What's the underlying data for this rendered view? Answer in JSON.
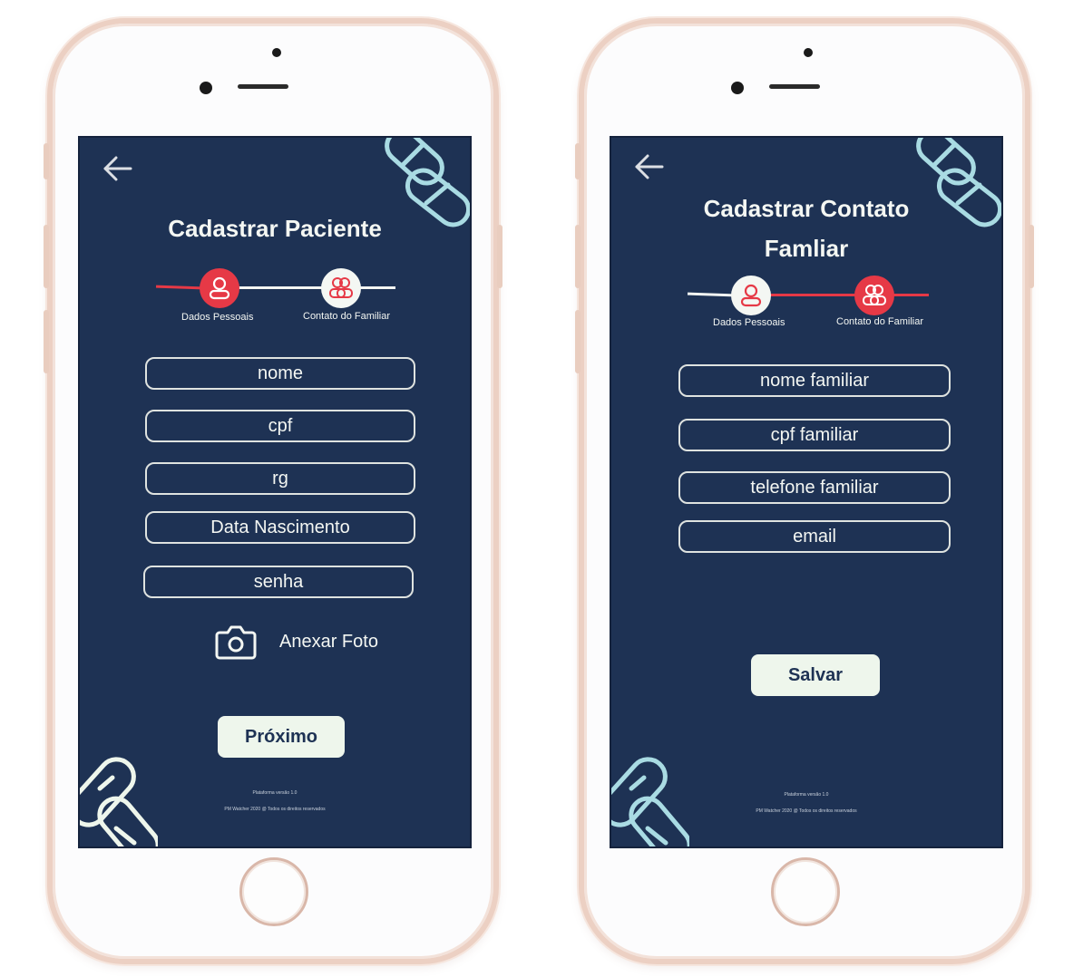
{
  "colors": {
    "screen_bg": "#1e3254",
    "accent_red": "#e63946",
    "pill_teal": "#a9dbe3",
    "button_bg": "#eef6ec",
    "text_light": "#f4f7f3"
  },
  "screen1": {
    "title": "Cadastrar Paciente",
    "steps": [
      {
        "label": "Dados Pessoais",
        "icon": "user-icon",
        "active": true
      },
      {
        "label": "Contato do Familiar",
        "icon": "users-icon",
        "active": false
      }
    ],
    "fields": [
      {
        "placeholder": "nome"
      },
      {
        "placeholder": "cpf"
      },
      {
        "placeholder": "rg"
      },
      {
        "placeholder": "Data Nascimento"
      },
      {
        "placeholder": "senha"
      }
    ],
    "attach_label": "Anexar Foto",
    "attach_icon": "camera-icon",
    "next_label": "Próximo",
    "footer_version": "Plataforma versão 1.0",
    "footer_copyright": "PM Watcher 2020 @ Todos os direitos reservados"
  },
  "screen2": {
    "title_line1": "Cadastrar Contato",
    "title_line2": "Famliar",
    "steps": [
      {
        "label": "Dados Pessoais",
        "icon": "user-icon",
        "active": false
      },
      {
        "label": "Contato do Familiar",
        "icon": "users-icon",
        "active": true
      }
    ],
    "fields": [
      {
        "placeholder": "nome familiar"
      },
      {
        "placeholder": "cpf familiar"
      },
      {
        "placeholder": "telefone familiar"
      },
      {
        "placeholder": "email"
      }
    ],
    "save_label": "Salvar",
    "footer_version": "Plataforma versão 1.0",
    "footer_copyright": "PM Watcher 2020 @ Todos os direitos reservados"
  }
}
